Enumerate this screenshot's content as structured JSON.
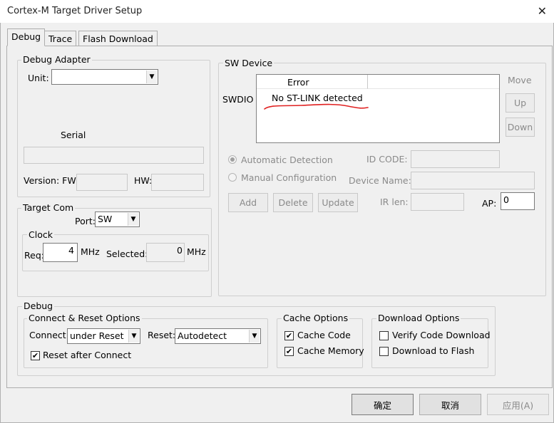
{
  "window": {
    "title": "Cortex-M Target Driver Setup"
  },
  "tabs": [
    {
      "label": "Debug"
    },
    {
      "label": "Trace"
    },
    {
      "label": "Flash Download"
    }
  ],
  "debug_adapter": {
    "group_label": "Debug Adapter",
    "unit_label": "Unit:",
    "unit_value": "",
    "serial_label": "Serial",
    "serial_value": "",
    "version_label": "Version: FW:",
    "fw_value": "",
    "hw_label": "HW:",
    "hw_value": ""
  },
  "target_com": {
    "group_label": "Target Com",
    "port_label": "Port:",
    "port_value": "SW",
    "clock": {
      "group_label": "Clock",
      "req_label": "Req:",
      "req_value": "4",
      "req_unit": "MHz",
      "selected_label": "Selected:",
      "selected_value": "0",
      "selected_unit": "MHz"
    }
  },
  "sw_device": {
    "group_label": "SW Device",
    "column_header": "Error",
    "row_label": "SWDIO",
    "row_value": "No ST-LINK detected",
    "move_label": "Move",
    "up_label": "Up",
    "down_label": "Down",
    "auto_detection_label": "Automatic Detection",
    "manual_config_label": "Manual Configuration",
    "id_code_label": "ID CODE:",
    "id_code_value": "",
    "device_name_label": "Device Name:",
    "device_name_value": "",
    "ir_len_label": "IR len:",
    "ir_len_value": "",
    "ap_label": "AP:",
    "ap_value": "0",
    "add_label": "Add",
    "delete_label": "Delete",
    "update_label": "Update",
    "annotation_color": "#e02020"
  },
  "debug": {
    "group_label": "Debug",
    "connect_reset": {
      "group_label": "Connect & Reset Options",
      "connect_label": "Connect:",
      "connect_value": "under Reset",
      "reset_label": "Reset:",
      "reset_value": "Autodetect",
      "reset_after_connect_label": "Reset after Connect",
      "reset_after_connect_checked": true
    },
    "cache": {
      "group_label": "Cache Options",
      "cache_code_label": "Cache Code",
      "cache_code_checked": true,
      "cache_memory_label": "Cache Memory",
      "cache_memory_checked": true
    },
    "download": {
      "group_label": "Download Options",
      "verify_label": "Verify Code Download",
      "verify_checked": false,
      "flash_label": "Download to Flash",
      "flash_checked": false
    }
  },
  "buttons": {
    "ok": "确定",
    "cancel": "取消",
    "apply": "应用(A)"
  },
  "icons": {
    "close": "close-icon",
    "dropdown": "chevron-down-icon",
    "check": "check-icon"
  }
}
